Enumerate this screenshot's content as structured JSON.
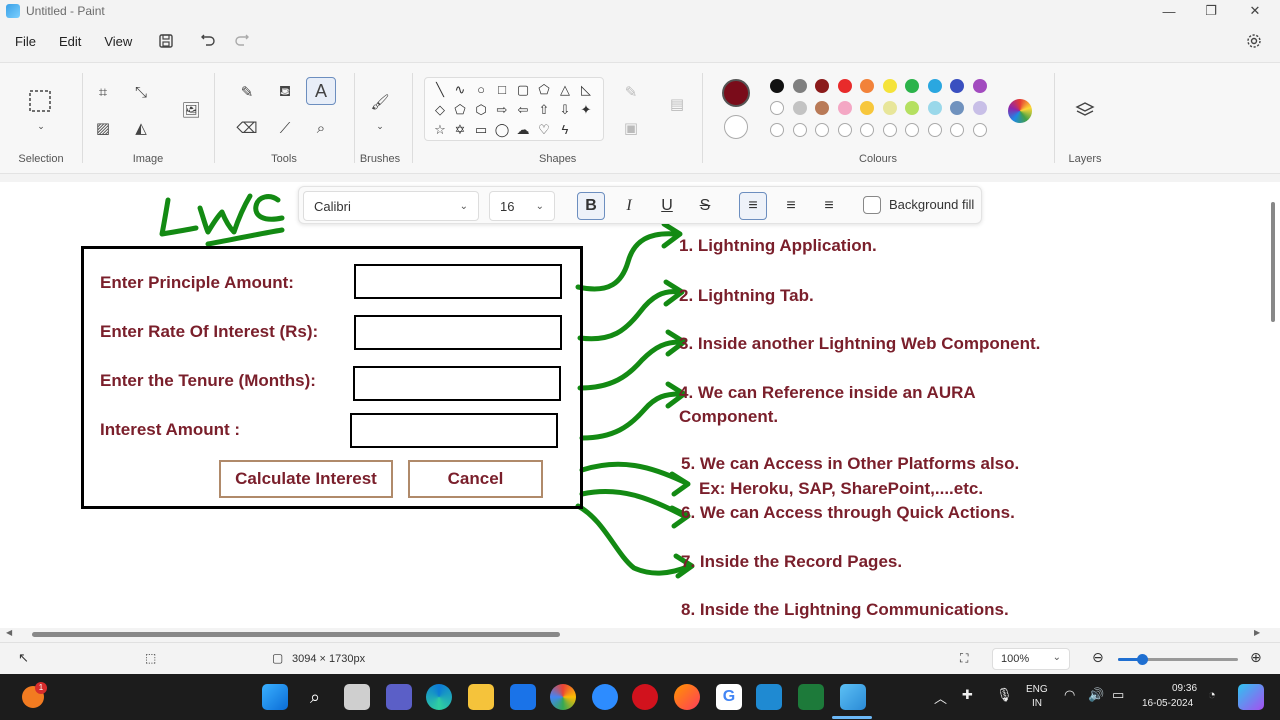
{
  "window": {
    "title": "Untitled - Paint"
  },
  "menu": [
    "File",
    "Edit",
    "View"
  ],
  "ribbon": {
    "groups": [
      "Selection",
      "Image",
      "Tools",
      "Brushes",
      "Shapes",
      "Colours",
      "Layers"
    ]
  },
  "text_toolbar": {
    "font": "Calibri",
    "size": "16",
    "background_fill": "Background fill"
  },
  "colors": {
    "primary": "#7a0c1a",
    "secondary": "#ffffff",
    "text_color": "#7a1f2b",
    "arrow_color": "#138a13",
    "row1": [
      "#111111",
      "#7f7f7f",
      "#8b1a1a",
      "#e82b2b",
      "#f2823a",
      "#f5e33a",
      "#2bb34a",
      "#2aa7e0",
      "#3a4fc0",
      "#a24bbf"
    ],
    "row2": [
      "#ffffff",
      "#c3c3c3",
      "#b97a57",
      "#f4a7c4",
      "#f7c73c",
      "#e8e69a",
      "#b5e061",
      "#9ad8ea",
      "#7092be",
      "#c8bfe7"
    ]
  },
  "drawing": {
    "handwritten": "LWC",
    "form": {
      "labels": [
        "Enter Principle Amount:",
        "Enter Rate Of Interest (Rs):",
        "Enter the Tenure (Months):",
        "Interest Amount :"
      ],
      "buttons": [
        "Calculate Interest",
        "Cancel"
      ]
    },
    "list": [
      "1. Lightning Application.",
      "2. Lightning Tab.",
      "3. Inside another Lightning Web Component.",
      "4. We can Reference inside an AURA",
      "Component.",
      "5. We can Access in Other Platforms also.",
      "Ex: Heroku, SAP, SharePoint,....etc.",
      "6. We can Access through Quick Actions.",
      "7. Inside the Record Pages.",
      "8. Inside the Lightning Communications."
    ]
  },
  "status": {
    "dimensions": "3094 × 1730px",
    "zoom": "100%",
    "zoom_level_fraction": 0.2
  },
  "taskbar": {
    "lang_top": "ENG",
    "lang_bottom": "IN",
    "time": "09:36",
    "date": "16-05-2024",
    "notification_count": "1"
  }
}
